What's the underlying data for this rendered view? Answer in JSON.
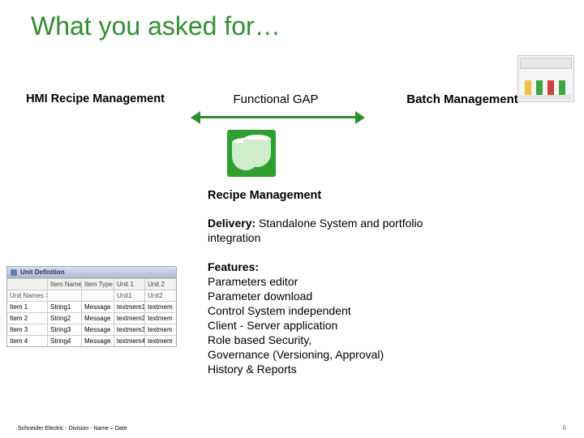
{
  "title": "What you asked for…",
  "labels": {
    "left": "HMI Recipe Management",
    "mid": "Functional GAP",
    "right": "Batch Management"
  },
  "recipe": {
    "heading": "Recipe Management",
    "delivery_label": "Delivery:",
    "delivery_text": " Standalone System and portfolio integration",
    "features_label": "Features:",
    "features": [
      "Parameters editor",
      "Parameter download",
      "Control System independent",
      "Client - Server application",
      "Role based Security,",
      "Governance (Versioning, Approval)",
      "History & Reports"
    ]
  },
  "unit_table": {
    "title": "Unit Definition",
    "headers": [
      "",
      "Item Name",
      "Item Type",
      "Unit 1",
      "Unit 2"
    ],
    "subhead": [
      "Unit Names >>>",
      "",
      "",
      "Unit1",
      "Unit2"
    ],
    "rows": [
      [
        "Item 1",
        "String1",
        "Message",
        "textmem1",
        "textmem"
      ],
      [
        "Item 2",
        "String2",
        "Message",
        "textmem2",
        "textmem"
      ],
      [
        "Item 3",
        "String3",
        "Message",
        "textmem3",
        "textmem"
      ],
      [
        "Item 4",
        "String4",
        "Message",
        "textmem4",
        "textmem"
      ]
    ]
  },
  "footer": "Schneider Electric - Division - Name – Date",
  "page": "6"
}
